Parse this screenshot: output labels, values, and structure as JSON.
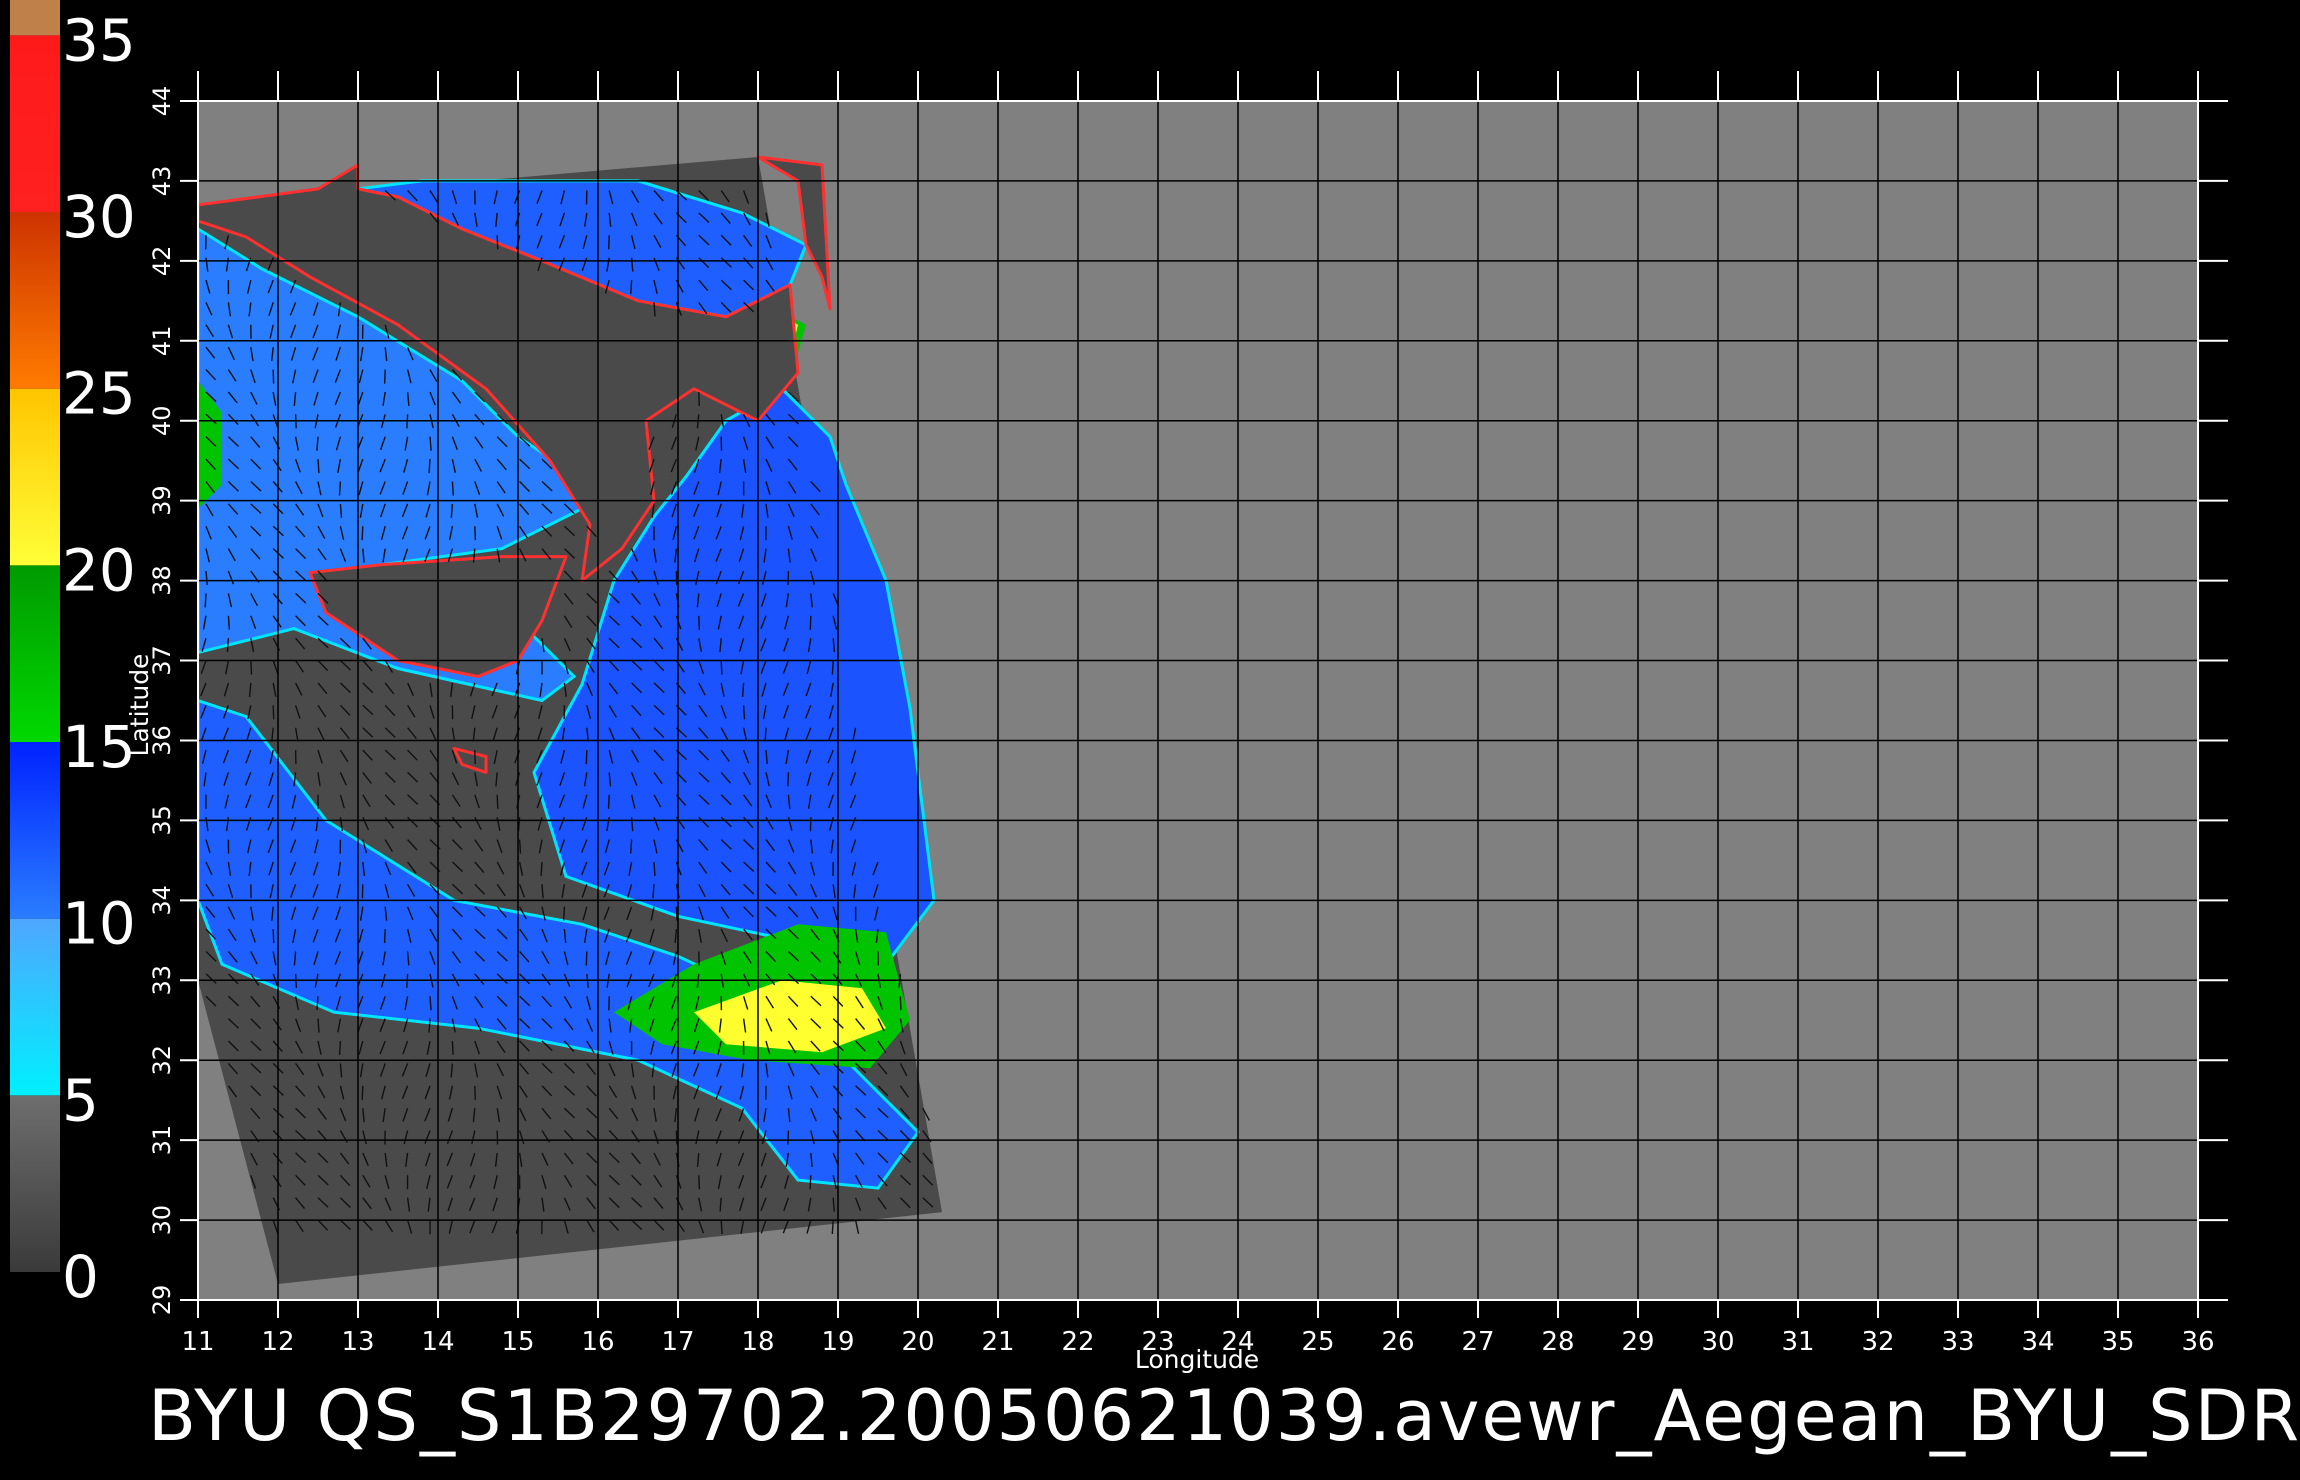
{
  "title": "BYU  QS_S1B29702.20050621039.avewr_Aegean_BYU_SDR",
  "colorbar": {
    "labels": [
      "35",
      "30",
      "25",
      "20",
      "15",
      "10",
      "5",
      "0"
    ],
    "segments": [
      {
        "from": 0,
        "to": 5,
        "top_color": "#6e6e6e",
        "bottom_color": "#3a3a3a"
      },
      {
        "from": 5,
        "to": 10,
        "top_color": "#4fa6ff",
        "bottom_color": "#00f0ff"
      },
      {
        "from": 10,
        "to": 15,
        "top_color": "#0022ff",
        "bottom_color": "#2a7dff"
      },
      {
        "from": 15,
        "to": 20,
        "top_color": "#009a00",
        "bottom_color": "#00d800"
      },
      {
        "from": 20,
        "to": 25,
        "top_color": "#ffc400",
        "bottom_color": "#ffff38"
      },
      {
        "from": 25,
        "to": 30,
        "top_color": "#cc3300",
        "bottom_color": "#ff7b00"
      },
      {
        "from": 30,
        "to": 35,
        "top_color": "#ff1a1a",
        "bottom_color": "#ff2020"
      },
      {
        "from": 35,
        "to": 36,
        "top_color": "#c0804a",
        "bottom_color": "#c0804a"
      }
    ]
  },
  "axes": {
    "xlabel": "Longitude",
    "ylabel": "Latitude",
    "x_ticks": [
      "11",
      "12",
      "13",
      "14",
      "15",
      "16",
      "17",
      "18",
      "19",
      "20",
      "21",
      "22",
      "23",
      "24",
      "25",
      "26",
      "27",
      "28",
      "29",
      "30",
      "31",
      "32",
      "33",
      "34",
      "35",
      "36"
    ],
    "y_ticks": [
      "29",
      "30",
      "31",
      "32",
      "33",
      "34",
      "35",
      "36",
      "37",
      "38",
      "39",
      "40",
      "41",
      "42",
      "43",
      "44"
    ],
    "xlim": [
      11,
      36
    ],
    "ylim": [
      29,
      44
    ]
  },
  "colors": {
    "background": "#000000",
    "land_mask": "#4a4a4a",
    "no_data": "#808080",
    "grid": "#000000"
  },
  "swath": {
    "corners_lonlat": [
      [
        11.0,
        42.7
      ],
      [
        18.0,
        43.3
      ],
      [
        20.3,
        30.1
      ],
      [
        12.0,
        29.2
      ],
      [
        11.0,
        33.0
      ]
    ]
  },
  "map": {
    "sea_regions": [
      {
        "name": "tyrrhenian-ionian-sea",
        "color": "#1f5fff",
        "points": [
          [
            11.0,
            36.5
          ],
          [
            11.6,
            36.3
          ],
          [
            12.6,
            35.0
          ],
          [
            14.2,
            34.0
          ],
          [
            15.8,
            33.7
          ],
          [
            17.0,
            33.3
          ],
          [
            18.5,
            32.6
          ],
          [
            19.4,
            31.7
          ],
          [
            20.0,
            31.1
          ],
          [
            19.5,
            30.4
          ],
          [
            18.5,
            30.5
          ],
          [
            17.8,
            31.4
          ],
          [
            16.5,
            32.0
          ],
          [
            14.5,
            32.4
          ],
          [
            12.7,
            32.6
          ],
          [
            11.3,
            33.2
          ],
          [
            11.0,
            34.0
          ]
        ]
      },
      {
        "name": "tyrrhenian-sea",
        "color": "#2a7dff",
        "points": [
          [
            11.0,
            42.4
          ],
          [
            11.8,
            41.9
          ],
          [
            13.0,
            41.3
          ],
          [
            14.3,
            40.5
          ],
          [
            15.0,
            39.8
          ],
          [
            15.6,
            39.4
          ],
          [
            15.8,
            38.9
          ],
          [
            14.8,
            38.4
          ],
          [
            13.3,
            38.2
          ],
          [
            12.6,
            38.0
          ],
          [
            13.5,
            37.6
          ],
          [
            15.1,
            37.4
          ],
          [
            15.7,
            36.8
          ],
          [
            15.3,
            36.5
          ],
          [
            13.5,
            36.9
          ],
          [
            12.2,
            37.4
          ],
          [
            11.0,
            37.1
          ]
        ]
      },
      {
        "name": "ionian-sea",
        "color": "#1a53ff",
        "points": [
          [
            16.2,
            38.0
          ],
          [
            16.7,
            38.8
          ],
          [
            17.1,
            39.3
          ],
          [
            17.6,
            40.0
          ],
          [
            18.3,
            40.4
          ],
          [
            18.9,
            39.8
          ],
          [
            19.1,
            39.2
          ],
          [
            19.6,
            38.0
          ],
          [
            19.9,
            36.4
          ],
          [
            20.2,
            34.0
          ],
          [
            19.6,
            33.2
          ],
          [
            18.4,
            33.5
          ],
          [
            17.0,
            33.8
          ],
          [
            15.6,
            34.3
          ],
          [
            15.2,
            35.6
          ],
          [
            15.8,
            36.7
          ]
        ]
      },
      {
        "name": "adriatic-sea",
        "color": "#1f5fff",
        "points": [
          [
            13.0,
            42.9
          ],
          [
            13.8,
            43.0
          ],
          [
            16.5,
            43.0
          ],
          [
            17.8,
            42.6
          ],
          [
            18.6,
            42.2
          ],
          [
            18.4,
            41.7
          ],
          [
            17.6,
            41.3
          ],
          [
            16.5,
            41.5
          ],
          [
            15.3,
            42.0
          ],
          [
            14.3,
            42.4
          ],
          [
            13.5,
            42.8
          ]
        ]
      }
    ],
    "wind_zones": [
      {
        "name": "gulf-of-sidra-high-wind",
        "color": "#00c400",
        "points": [
          [
            16.2,
            32.6
          ],
          [
            17.2,
            33.2
          ],
          [
            18.5,
            33.7
          ],
          [
            19.6,
            33.6
          ],
          [
            19.9,
            32.5
          ],
          [
            19.4,
            31.9
          ],
          [
            17.9,
            32.0
          ],
          [
            16.8,
            32.2
          ]
        ]
      },
      {
        "name": "gulf-of-sidra-peak-wind",
        "color": "#ffff30",
        "points": [
          [
            17.2,
            32.6
          ],
          [
            18.3,
            33.0
          ],
          [
            19.3,
            32.9
          ],
          [
            19.6,
            32.4
          ],
          [
            18.8,
            32.1
          ],
          [
            17.6,
            32.2
          ]
        ]
      },
      {
        "name": "apulia-wind",
        "color": "#00c400",
        "points": [
          [
            17.6,
            40.9
          ],
          [
            18.4,
            40.5
          ],
          [
            18.6,
            41.2
          ],
          [
            18.0,
            41.5
          ]
        ]
      },
      {
        "name": "apulia-peak-wind",
        "color": "#ffff30",
        "points": [
          [
            17.9,
            41.1
          ],
          [
            18.4,
            40.8
          ],
          [
            18.5,
            41.2
          ],
          [
            18.1,
            41.4
          ]
        ]
      },
      {
        "name": "sardinia-coast-wind",
        "color": "#00c400",
        "points": [
          [
            11.0,
            40.5
          ],
          [
            11.3,
            40.1
          ],
          [
            11.3,
            39.2
          ],
          [
            11.0,
            38.9
          ]
        ]
      }
    ],
    "land_masses": [
      {
        "name": "italy-mainland",
        "color": "#4a4a4a",
        "points": [
          [
            13.0,
            43.2
          ],
          [
            13.0,
            42.9
          ],
          [
            13.5,
            42.8
          ],
          [
            14.3,
            42.4
          ],
          [
            15.3,
            42.0
          ],
          [
            16.5,
            41.5
          ],
          [
            17.6,
            41.3
          ],
          [
            18.4,
            41.7
          ],
          [
            18.5,
            40.6
          ],
          [
            18.0,
            40.0
          ],
          [
            17.2,
            40.4
          ],
          [
            16.6,
            40.0
          ],
          [
            16.7,
            39.0
          ],
          [
            16.3,
            38.4
          ],
          [
            15.8,
            38.0
          ],
          [
            15.9,
            38.7
          ],
          [
            15.4,
            39.5
          ],
          [
            14.6,
            40.4
          ],
          [
            13.5,
            41.2
          ],
          [
            12.4,
            41.8
          ],
          [
            11.6,
            42.3
          ],
          [
            11.0,
            42.5
          ],
          [
            11.0,
            42.7
          ],
          [
            12.5,
            42.9
          ]
        ]
      },
      {
        "name": "sicily",
        "color": "#4a4a4a",
        "points": [
          [
            12.4,
            38.1
          ],
          [
            13.3,
            38.2
          ],
          [
            14.8,
            38.3
          ],
          [
            15.6,
            38.3
          ],
          [
            15.3,
            37.5
          ],
          [
            15.0,
            37.0
          ],
          [
            14.5,
            36.8
          ],
          [
            13.5,
            37.0
          ],
          [
            12.6,
            37.6
          ]
        ]
      },
      {
        "name": "malta",
        "color": "#4a4a4a",
        "points": [
          [
            14.2,
            35.9
          ],
          [
            14.6,
            35.8
          ],
          [
            14.6,
            35.6
          ],
          [
            14.3,
            35.7
          ]
        ]
      },
      {
        "name": "balkans-coast",
        "color": "#4a4a4a",
        "points": [
          [
            18.0,
            43.3
          ],
          [
            18.5,
            43.0
          ],
          [
            18.6,
            42.2
          ],
          [
            18.8,
            41.8
          ],
          [
            18.9,
            41.4
          ],
          [
            18.8,
            43.2
          ]
        ]
      }
    ]
  }
}
